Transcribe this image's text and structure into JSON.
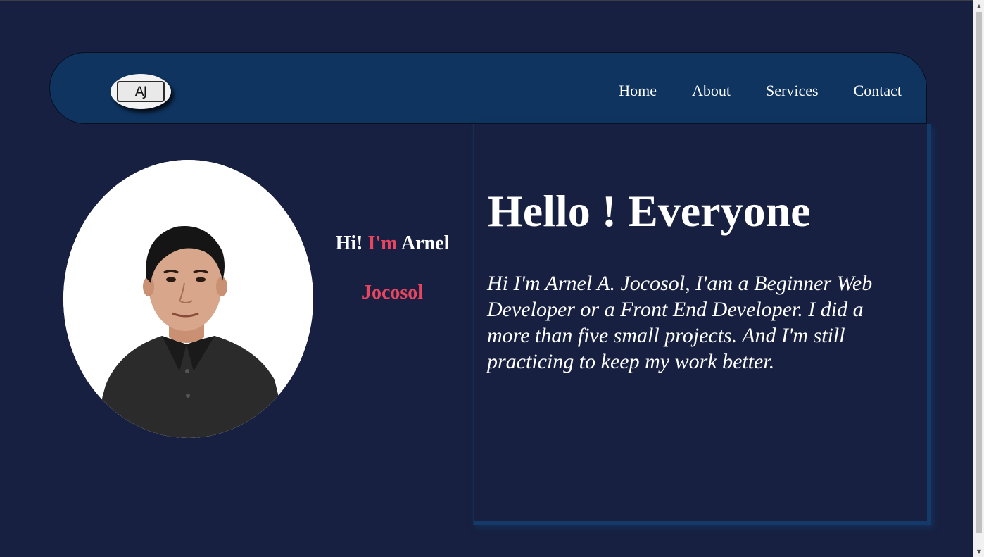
{
  "header": {
    "logo_text": "AJ",
    "nav": [
      "Home",
      "About",
      "Services",
      "Contact"
    ]
  },
  "profile": {
    "greeting_hi": "Hi! ",
    "greeting_im": "I'm",
    "greeting_name": " Arnel",
    "surname": "Jocosol"
  },
  "intro": {
    "title": "Hello ! Everyone",
    "body": "Hi I'm Arnel A. Jocosol, I'am a Beginner Web Developer or a Front End Developer. I did a more than five small projects. And I'm still practicing to keep my work better."
  },
  "colors": {
    "background": "#172040",
    "navbar": "#0f3460",
    "accent": "#e94560",
    "text": "#ffffff"
  }
}
